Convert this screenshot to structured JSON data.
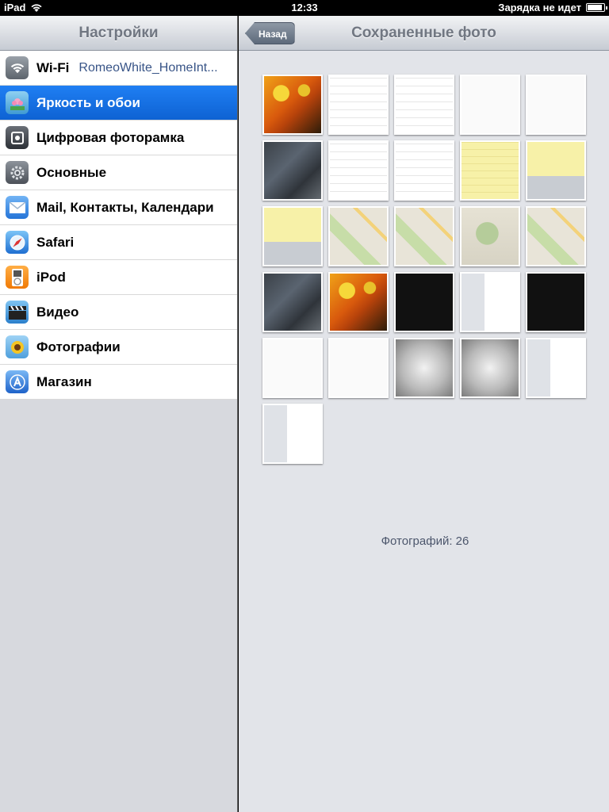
{
  "status_bar": {
    "device": "iPad",
    "time": "12:33",
    "battery_status": "Зарядка не идет",
    "battery_level": 0.9
  },
  "settings": {
    "title": "Настройки",
    "items": [
      {
        "label": "Wi-Fi",
        "detail": "RomeoWhite_HomeInt...",
        "icon": "wifi-icon",
        "selected": false
      },
      {
        "label": "Яркость и обои",
        "icon": "brightness-wallpaper-icon",
        "selected": true
      },
      {
        "label": "Цифровая фоторамка",
        "icon": "picture-frame-icon",
        "selected": false
      },
      {
        "label": "Основные",
        "icon": "gear-icon",
        "selected": false
      },
      {
        "label": "Mail, Контакты, Календари",
        "icon": "mail-icon",
        "selected": false
      },
      {
        "label": "Safari",
        "icon": "safari-compass-icon",
        "selected": false
      },
      {
        "label": "iPod",
        "icon": "ipod-icon",
        "selected": false
      },
      {
        "label": "Видео",
        "icon": "video-clapper-icon",
        "selected": false
      },
      {
        "label": "Фотографии",
        "icon": "sunflower-photos-icon",
        "selected": false
      },
      {
        "label": "Магазин",
        "icon": "app-store-icon",
        "selected": false
      }
    ]
  },
  "album": {
    "title": "Сохраненные фото",
    "back_label": "Назад",
    "photo_count_text": "Фотографий: 26",
    "thumbnails": [
      "butterfly-homescreen",
      "calendar-screenshot",
      "calendar-screenshot",
      "settings-screenshot",
      "settings-screenshot",
      "keyboard-dark",
      "notes-screenshot",
      "notes-screenshot",
      "yellow-notes",
      "yellow-notes-keyboard",
      "yellow-notes-keyboard",
      "map-screenshot",
      "map-screenshot",
      "map-popup-screenshot",
      "map-curl-screenshot",
      "aerial-screenshot",
      "butterfly-wallpaper",
      "ipod-screenshot",
      "ipod-album-screenshot",
      "ipod-cover-screenshot",
      "youtube-screenshot",
      "youtube-video-screenshot",
      "gray-alert-screenshot",
      "gray-alert-screenshot",
      "settings-split-screenshot",
      "settings-split-screenshot",
      "settings-split-screenshot"
    ]
  }
}
